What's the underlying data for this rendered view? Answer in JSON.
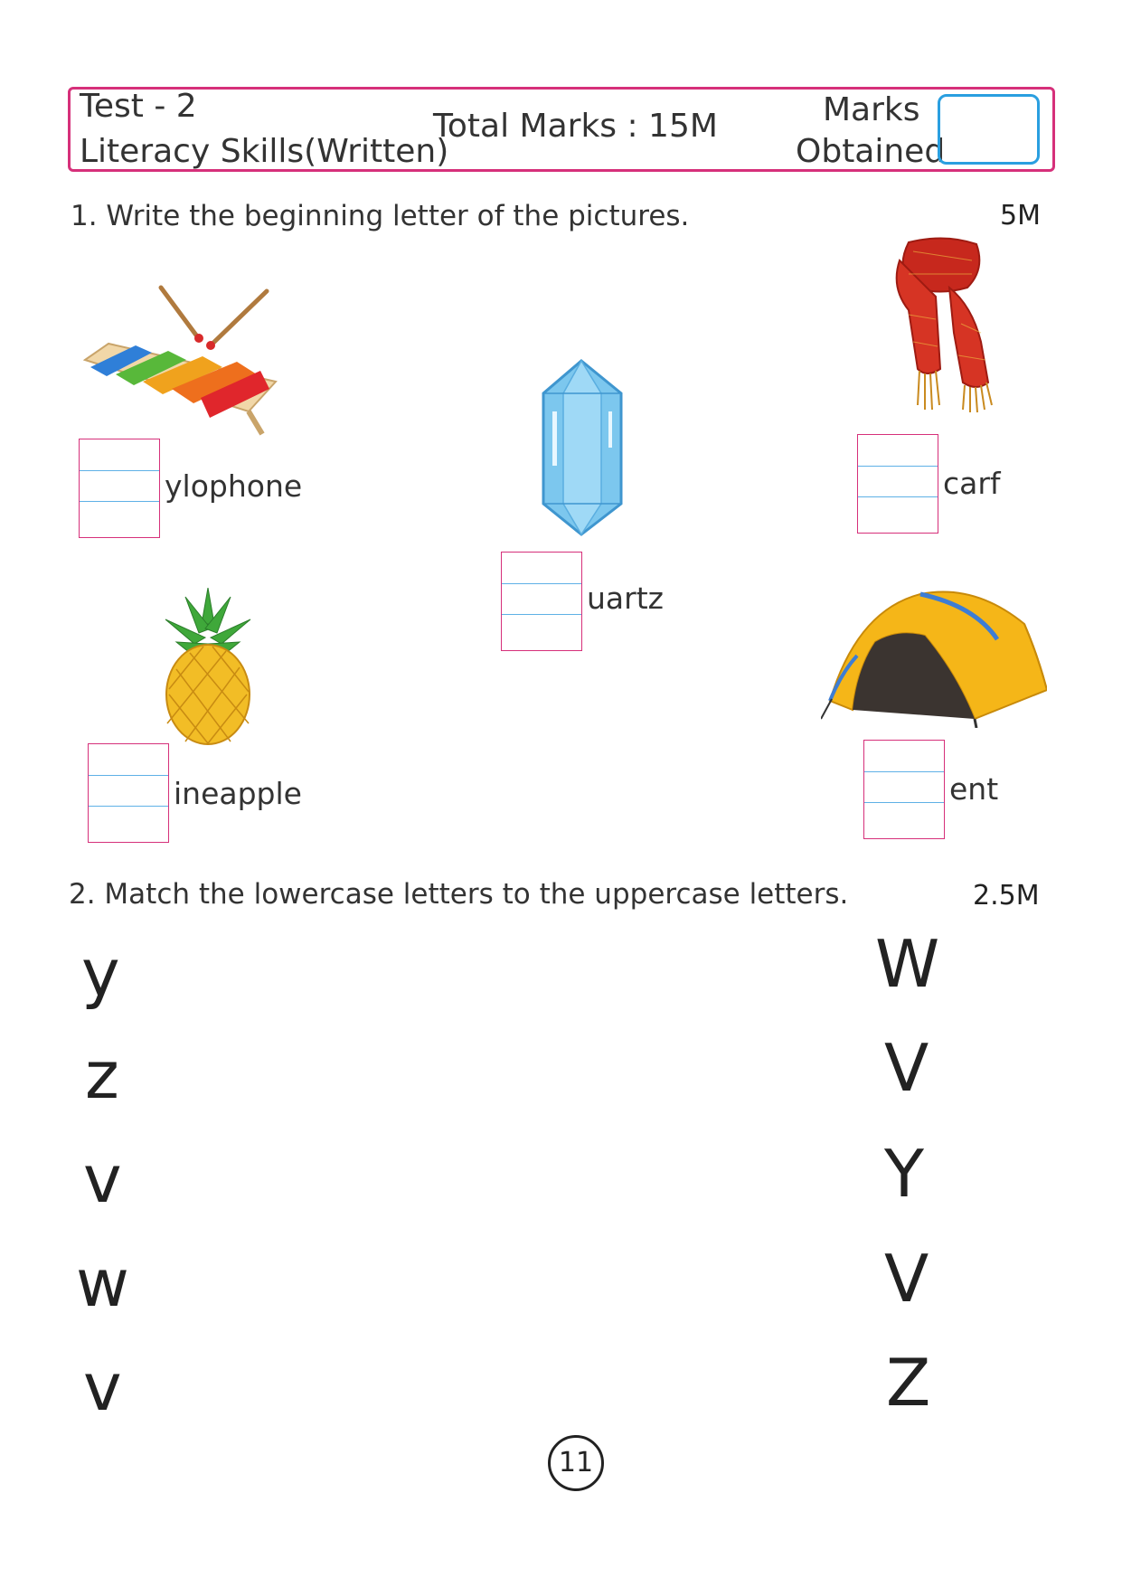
{
  "header": {
    "test_label": "Test - 2",
    "subject": "Literacy Skills(Written)",
    "total_marks": "Total Marks : 15M",
    "marks_label_1": "Marks",
    "marks_label_2": "Obtained"
  },
  "q1": {
    "title": "1. Write the beginning letter of the  pictures.",
    "marks": "5M",
    "items": [
      {
        "picture": "xylophone-image",
        "word": "ylophone"
      },
      {
        "picture": "quartz-image",
        "word": "uartz"
      },
      {
        "picture": "scarf-image",
        "word": "carf"
      },
      {
        "picture": "pineapple-image",
        "word": "ineapple"
      },
      {
        "picture": "tent-image",
        "word": "ent"
      }
    ]
  },
  "q2": {
    "title": "2. Match the lowercase letters to the uppercase letters.",
    "marks": "2.5M",
    "lowercase": [
      "y",
      "z",
      "v",
      "w",
      "v"
    ],
    "uppercase": [
      "W",
      "V",
      "Y",
      "V",
      "Z"
    ]
  },
  "footer": {
    "page_number": "11"
  }
}
